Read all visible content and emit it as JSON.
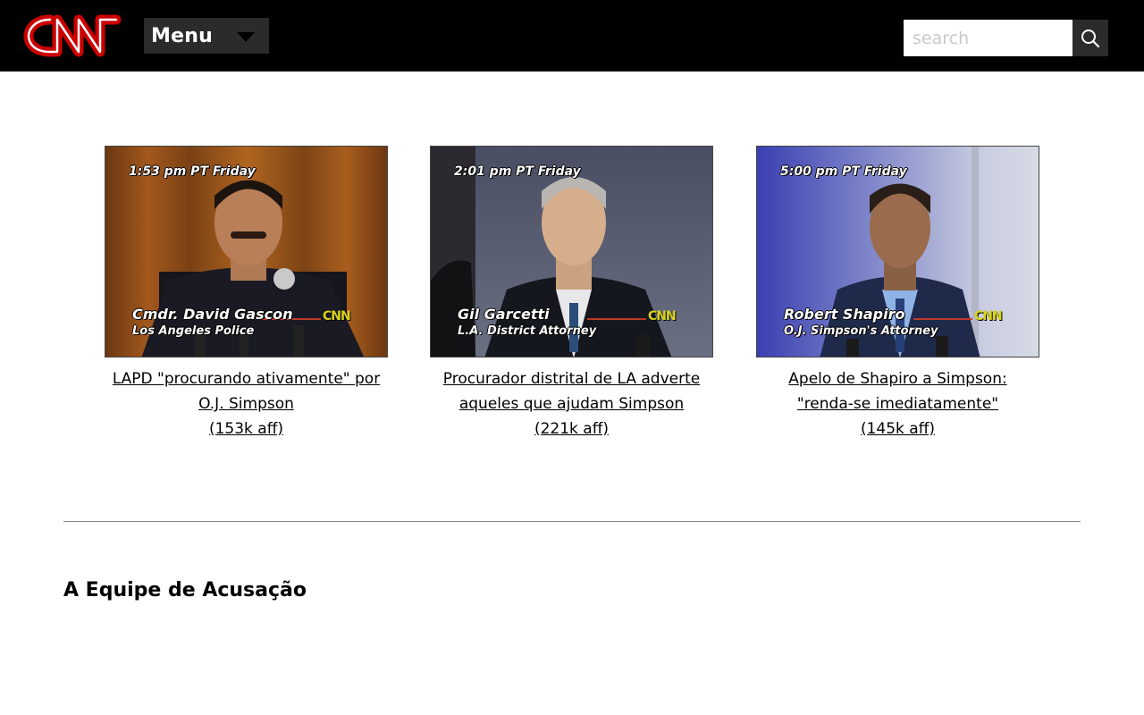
{
  "header": {
    "logo_text": "CNN",
    "menu_label": "Menu",
    "search_placeholder": "search"
  },
  "videos": [
    {
      "timestamp": "1:53 pm PT Friday",
      "name": "Cmdr. David Gascon",
      "title": "Los Angeles Police",
      "caption_line1": "LAPD \"procurando ativamente\" por",
      "caption_line2": "O.J. Simpson",
      "size": "(153k aff)"
    },
    {
      "timestamp": "2:01 pm PT Friday",
      "name": "Gil Garcetti",
      "title": "L.A. District Attorney",
      "caption_line1": "Procurador distrital de LA adverte",
      "caption_line2": "aqueles que ajudam Simpson",
      "size": "(221k aff)"
    },
    {
      "timestamp": "5:00 pm PT Friday",
      "name": "Robert Shapiro",
      "title": "O.J. Simpson's Attorney",
      "caption_line1": "Apelo de Shapiro a Simpson:",
      "caption_line2": "\"renda-se imediatamente\"",
      "size": "(145k aff)"
    }
  ],
  "bug_text": "CNN",
  "section_title": "A Equipe de Acusação",
  "colors": {
    "header_bg": "#000000",
    "logo_red": "#cc0000",
    "button_bg": "#2b2b2b"
  }
}
